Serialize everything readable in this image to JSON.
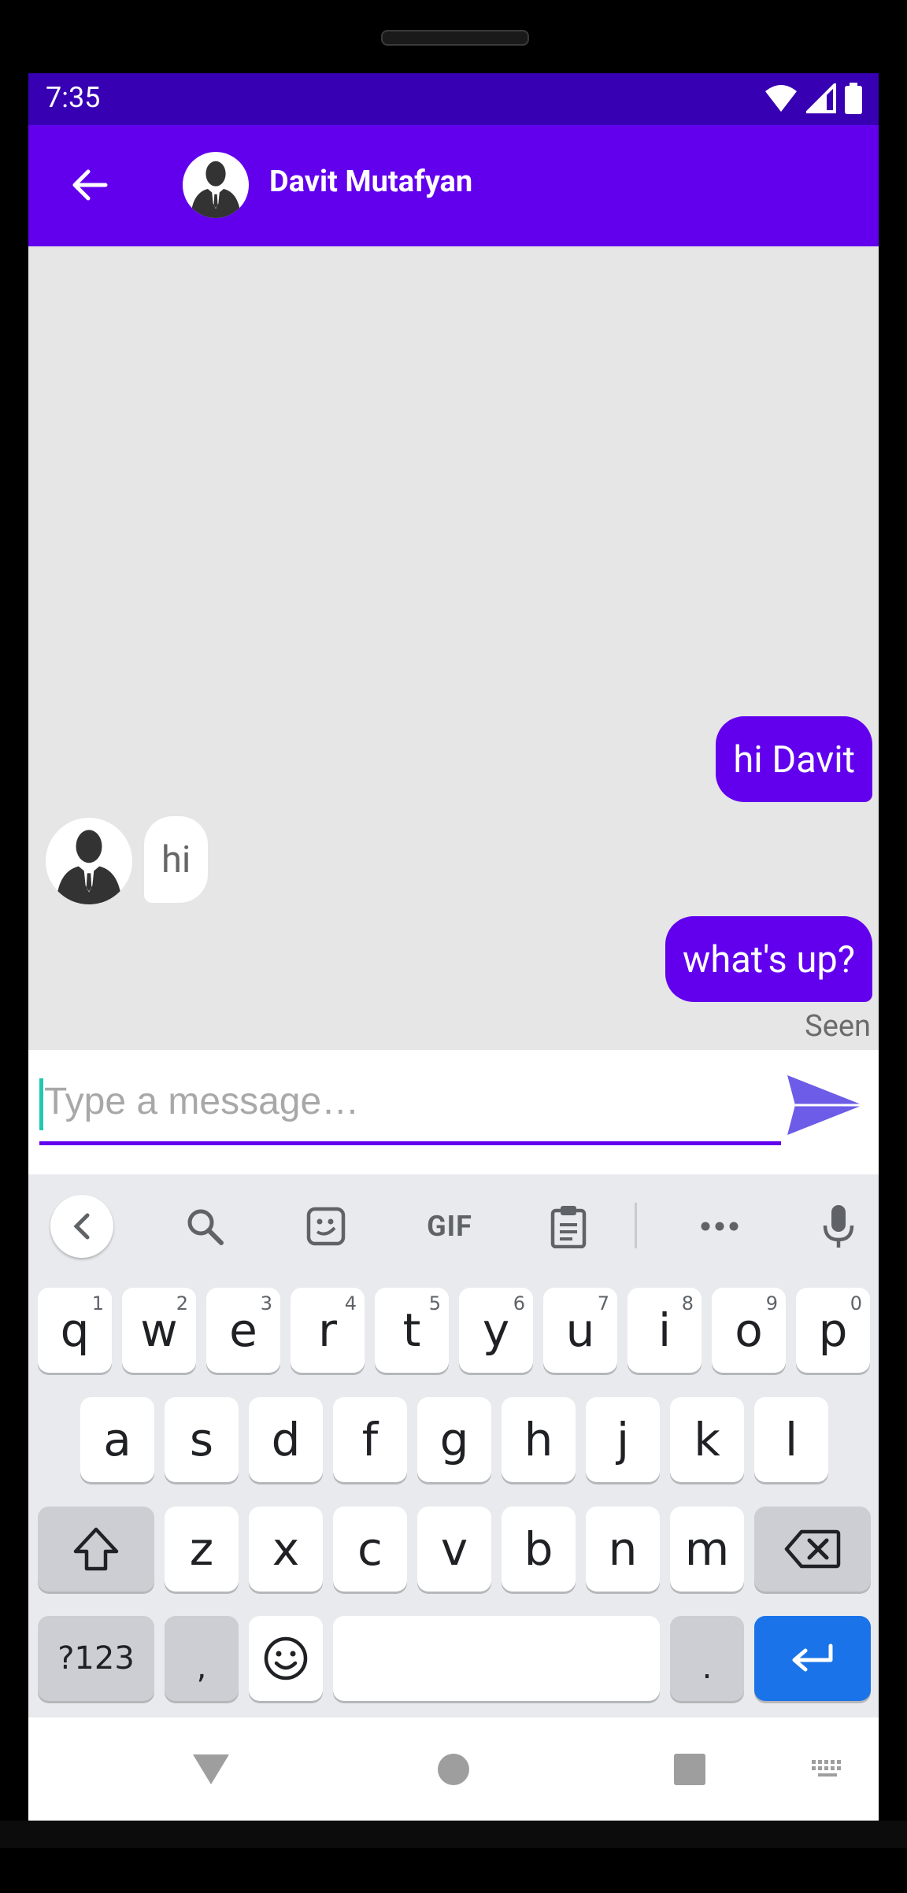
{
  "status_bar": {
    "time": "7:35"
  },
  "app_bar": {
    "contact_name": "Davit Mutafyan"
  },
  "messages": [
    {
      "direction": "outgoing",
      "text": "hi Davit"
    },
    {
      "direction": "incoming",
      "text": "hi"
    },
    {
      "direction": "outgoing",
      "text": "what's up?"
    }
  ],
  "seen_label": "Seen",
  "composer": {
    "placeholder": "Type a message…"
  },
  "keyboard": {
    "toolbar": [
      "back",
      "search",
      "sticker",
      "GIF",
      "clipboard",
      "more",
      "mic"
    ],
    "gif_label": "GIF",
    "row1": [
      "q",
      "w",
      "e",
      "r",
      "t",
      "y",
      "u",
      "i",
      "o",
      "p"
    ],
    "row1_numbers": [
      "1",
      "2",
      "3",
      "4",
      "5",
      "6",
      "7",
      "8",
      "9",
      "0"
    ],
    "row2": [
      "a",
      "s",
      "d",
      "f",
      "g",
      "h",
      "j",
      "k",
      "l"
    ],
    "row3": [
      "z",
      "x",
      "c",
      "v",
      "b",
      "n",
      "m"
    ],
    "symbols_label": "?123",
    "comma_label": ",",
    "period_label": "."
  },
  "colors": {
    "primary": "#6200ee",
    "status": "#3700b3",
    "accent": "#21c7b1",
    "enter_key": "#1a73e8"
  }
}
